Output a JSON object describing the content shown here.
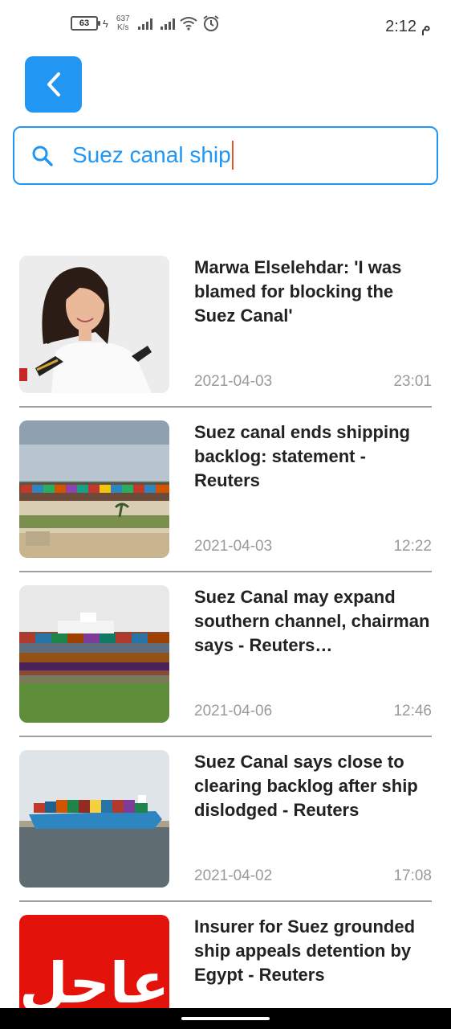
{
  "status_bar": {
    "battery": "63",
    "speed_value": "637",
    "speed_unit": "K/s",
    "time": "2:12 م"
  },
  "search": {
    "value": "Suez canal ship"
  },
  "articles": [
    {
      "headline": "Marwa Elselehdar: 'I was blamed for blocking the Suez Canal'",
      "date": "2021-04-03",
      "time": "23:01"
    },
    {
      "headline": "Suez canal ends shipping backlog: statement - Reuters",
      "date": "2021-04-03",
      "time": "12:22"
    },
    {
      "headline": "Suez Canal may expand southern channel, chairman says - Reuters…",
      "date": "2021-04-06",
      "time": "12:46"
    },
    {
      "headline": "Suez Canal says close to clearing backlog after ship dislodged - Reuters",
      "date": "2021-04-02",
      "time": "17:08"
    },
    {
      "headline": "Insurer for Suez grounded ship appeals detention by Egypt - Reuters",
      "date": "",
      "time": "",
      "thumb_text": "عاجل"
    }
  ],
  "colors": {
    "accent": "#2196f3",
    "caret": "#e5532d",
    "breaking_red": "#e3120b"
  }
}
